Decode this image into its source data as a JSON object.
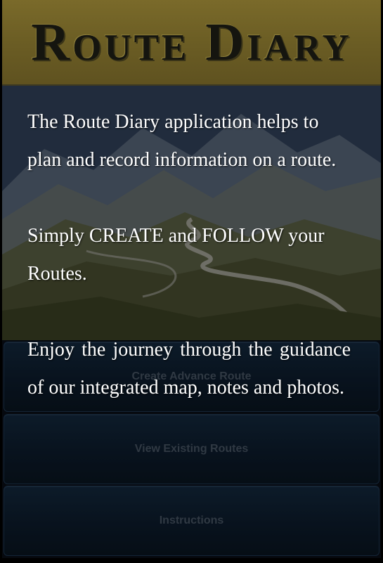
{
  "header": {
    "title": "Route Diary"
  },
  "intro": {
    "paragraph1": "The Route Diary application helps to plan and record information on a route.",
    "paragraph2": "Simply CREATE and FOLLOW your Routes.",
    "paragraph3": "Enjoy the journey through the guidance of our integrated map, notes and photos."
  },
  "menu": {
    "create_advance_route": "Create Advance Route",
    "view_existing_routes": "View Existing Routes",
    "instructions": "Instructions"
  },
  "colors": {
    "header_bg": "#6b5d24",
    "header_text": "#15150f",
    "button_bg": "#0d1d2e",
    "button_text": "#4a5868",
    "intro_text": "#ffffff"
  }
}
